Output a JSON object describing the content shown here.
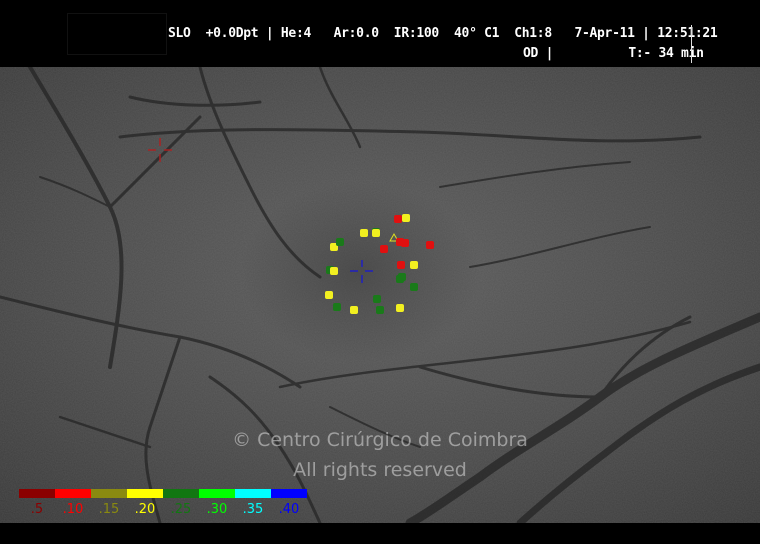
{
  "header": {
    "line1": "SLO  +0.0Dpt | He:4   Ar:0.0  IR:100  40° C1  Ch1:8   7-Apr-11 | 12:51:21",
    "line2": "OD |          T:- 34 min"
  },
  "watermark": {
    "line1": "© Centro Cirúrgico de Coimbra",
    "line2": "All rights reserved"
  },
  "legend": [
    {
      "label": ".5",
      "color": "#8b0000",
      "text_color": "#8b0000"
    },
    {
      "label": ".10",
      "color": "#ff0000",
      "text_color": "#ff0000"
    },
    {
      "label": ".15",
      "color": "#8a8a10",
      "text_color": "#8a8a10"
    },
    {
      "label": ".20",
      "color": "#ffff00",
      "text_color": "#ffff00"
    },
    {
      "label": ".25",
      "color": "#117711",
      "text_color": "#117711"
    },
    {
      "label": ".30",
      "color": "#00ff00",
      "text_color": "#00ff00"
    },
    {
      "label": ".35",
      "color": "#00ffff",
      "text_color": "#00ffff"
    },
    {
      "label": ".40",
      "color": "#0000ff",
      "text_color": "#0000ff"
    }
  ],
  "markers": {
    "fixation_cross": {
      "color": "#2020c0"
    },
    "reference_cross": {
      "color": "#b02020"
    },
    "triangle": {
      "color": "#e0e020"
    }
  },
  "points": [
    {
      "color": "red"
    },
    {
      "color": "yellow"
    },
    {
      "color": "green"
    },
    {
      "color": "yellow"
    },
    {
      "color": "yellow"
    },
    {
      "color": "green"
    },
    {
      "color": "red"
    },
    {
      "color": "red"
    },
    {
      "color": "red"
    },
    {
      "color": "red"
    },
    {
      "color": "red"
    },
    {
      "color": "yellow"
    },
    {
      "color": "green"
    },
    {
      "color": "yellow"
    },
    {
      "color": "green"
    },
    {
      "color": "green"
    },
    {
      "color": "yellow"
    },
    {
      "color": "green"
    },
    {
      "color": "yellow"
    },
    {
      "color": "green"
    },
    {
      "color": "yellow"
    },
    {
      "color": "green"
    },
    {
      "color": "yellow"
    },
    {
      "color": "green"
    }
  ],
  "colors": {
    "red": "#e01010",
    "yellow": "#f2f020",
    "green": "#1a7a1a"
  }
}
